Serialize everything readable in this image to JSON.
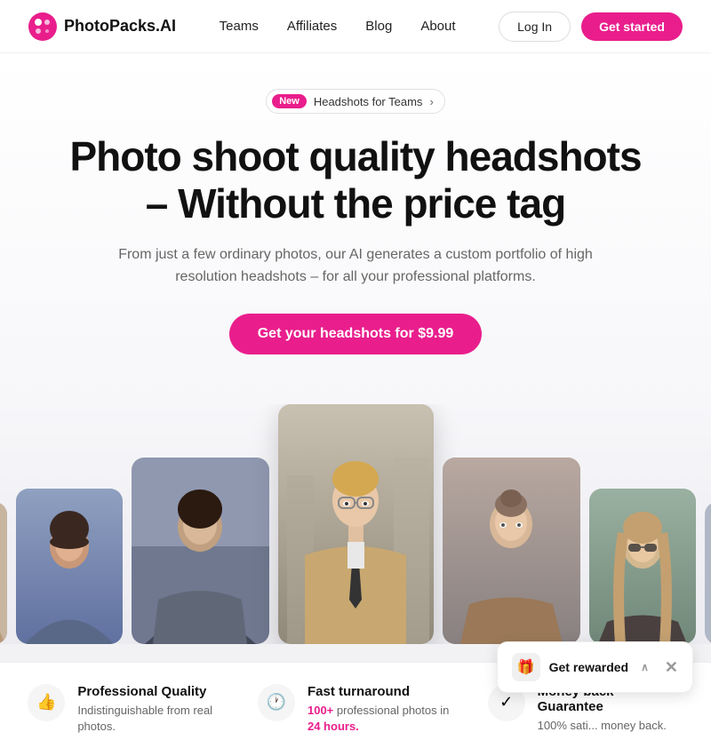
{
  "brand": {
    "name": "PhotoPacks.AI"
  },
  "nav": {
    "links": [
      {
        "label": "Teams",
        "id": "teams"
      },
      {
        "label": "Affiliates",
        "id": "affiliates"
      },
      {
        "label": "Blog",
        "id": "blog"
      },
      {
        "label": "About",
        "id": "about"
      }
    ],
    "login_label": "Log In",
    "cta_label": "Get started"
  },
  "badge": {
    "new_label": "New",
    "text": "Headshots for Teams",
    "arrow": "›"
  },
  "hero": {
    "title_line1": "Photo shoot quality headshots",
    "title_line2": "– Without the price tag",
    "subtitle": "From just a few ordinary photos, our AI generates a custom portfolio of high resolution headshots – for all your professional platforms.",
    "cta_label": "Get your headshots for $9.99"
  },
  "photos": [
    {
      "id": "p1",
      "class": "card-sm ph1",
      "person": "👤"
    },
    {
      "id": "p2",
      "class": "card-md ph2",
      "person": "👤"
    },
    {
      "id": "p3",
      "class": "card-lg ph3",
      "person": "👤"
    },
    {
      "id": "p4",
      "class": "card-center ph4",
      "person": "👤"
    },
    {
      "id": "p5",
      "class": "card-lg ph5",
      "person": "👤"
    },
    {
      "id": "p6",
      "class": "card-md ph6",
      "person": "👤"
    },
    {
      "id": "p7",
      "class": "card-sm ph7",
      "person": "👤"
    }
  ],
  "features": [
    {
      "icon": "👍",
      "title": "Professional Quality",
      "desc": "Indistinguishable from real photos.",
      "highlight": ""
    },
    {
      "icon": "🕐",
      "title": "Fast turnaround",
      "desc_pre": "",
      "highlight": "100+ professional photos in",
      "desc_post": "24 hours.",
      "highlight2": "24 hours."
    },
    {
      "icon": "✓",
      "title": "Money back Guarantee",
      "desc": "100% sati... money back.",
      "highlight": ""
    }
  ],
  "toast": {
    "icon": "🎁",
    "label": "Get rewarded",
    "chevron": "∧"
  }
}
